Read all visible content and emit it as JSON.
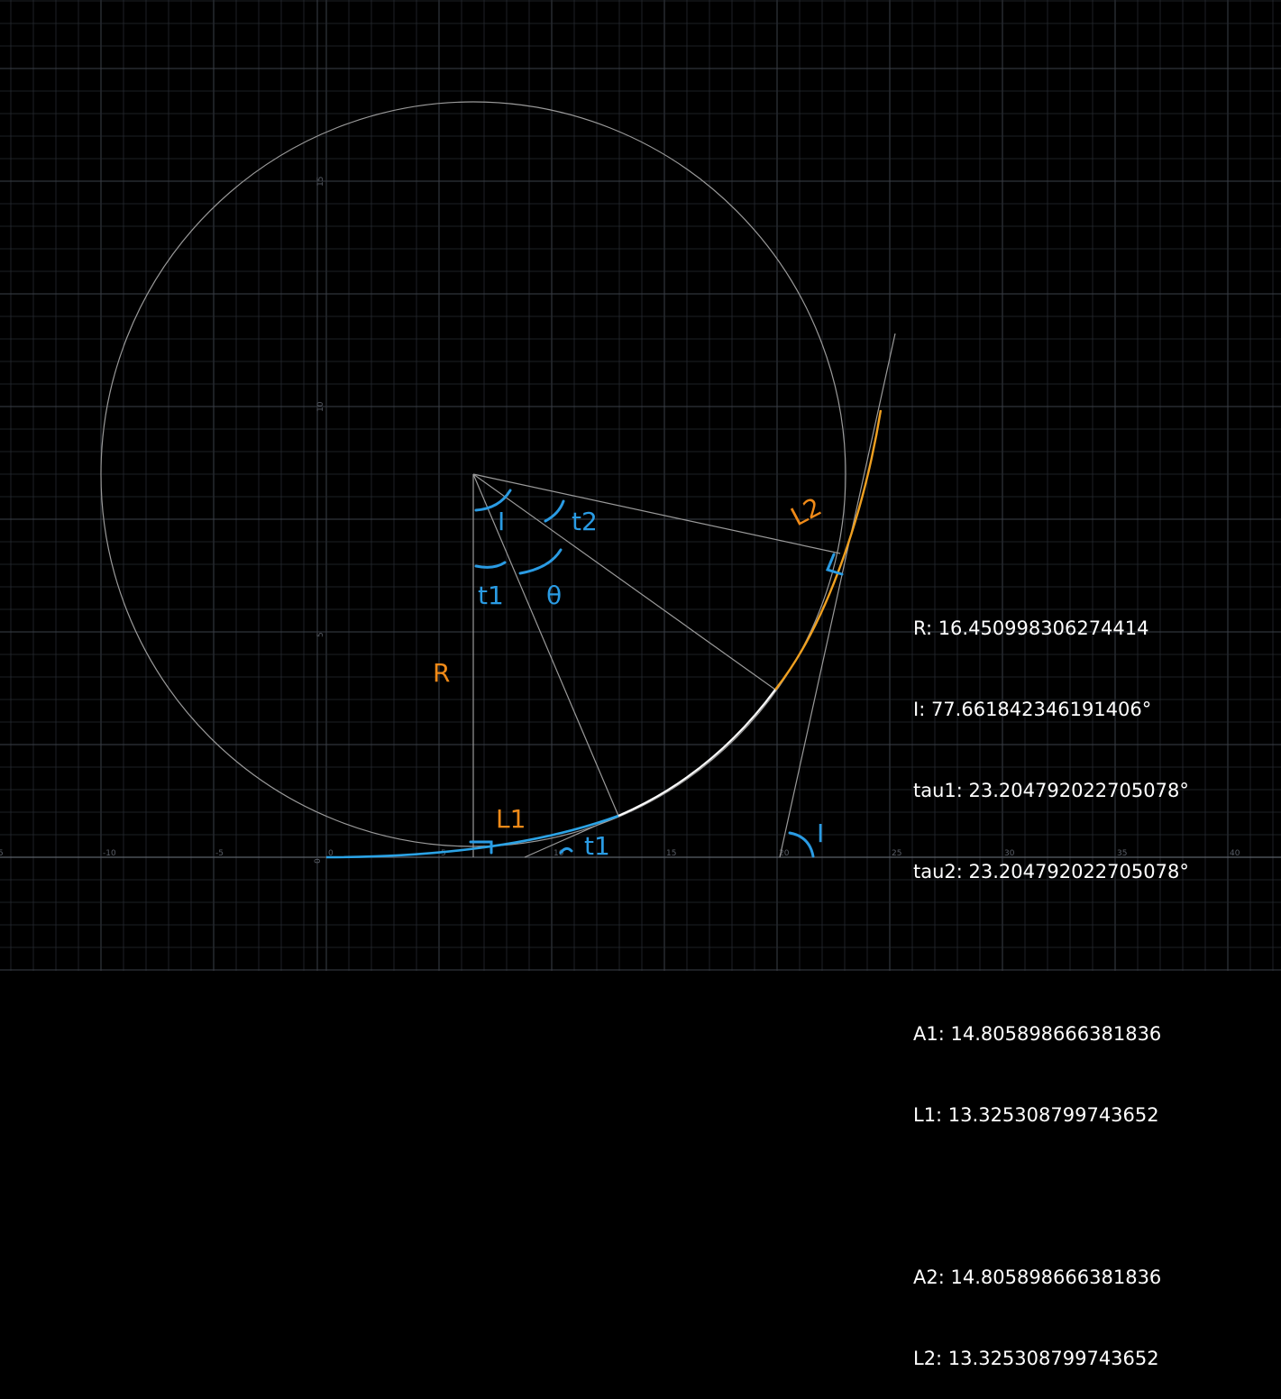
{
  "colors": {
    "background": "#000000",
    "grid_minor": "#262a30",
    "grid_major": "#3a3f47",
    "axis": "#5a5f68",
    "construction": "#9a9a9a",
    "spiral_entry": "#2ba3e6",
    "spiral_exit": "#f0a020",
    "curve": "#ffffff",
    "label_orange": "#f08a18",
    "label_blue": "#2a9be3"
  },
  "axes": {
    "x_ticks": [
      "-15",
      "-10",
      "-5",
      "0",
      "5",
      "10",
      "15",
      "20",
      "25",
      "30",
      "35",
      "40"
    ],
    "y_ticks": [
      "5",
      "10",
      "15",
      "20",
      "25",
      "30",
      "35"
    ]
  },
  "annotations": {
    "R": "R",
    "L1": "L1",
    "L2": "L2",
    "I_center": "I",
    "I_pi": "I",
    "t2": "t2",
    "t1_center": "t1",
    "theta": "θ",
    "t1_base": "t1"
  },
  "readout": {
    "R": "R: 16.450998306274414",
    "I": "I: 77.661842346191406°",
    "tau1": "tau1: 23.204792022705078°",
    "tau2": "tau2: 23.204792022705078°",
    "A1": "A1: 14.805898666381836",
    "L1": "L1: 13.325308799743652",
    "A2": "A2: 14.805898666381836",
    "L2": "L2: 13.325308799743652"
  },
  "geometry": {
    "radius": 16.450998306274414,
    "intersection_angle_deg": 77.6618423461914,
    "tau1_deg": 23.204792022705078,
    "tau2_deg": 23.204792022705078,
    "A1": 14.805898666381836,
    "L1": 13.325308799743652,
    "A2": 14.805898666381836,
    "L2": 13.325308799743652
  }
}
